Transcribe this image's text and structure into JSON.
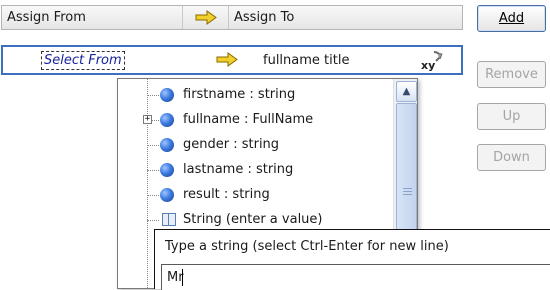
{
  "grid": {
    "headers": {
      "assign_from": "Assign From",
      "assign_to": "Assign To"
    },
    "row": {
      "from": "Select From",
      "to": "fullname title"
    },
    "arrow_icon": "yellow-right-arrow-icon",
    "xy_icon": "xy-function-icon",
    "xy_label": "xy"
  },
  "buttons": [
    {
      "label": "Add",
      "mnemonic_index": 0,
      "enabled": true
    },
    {
      "label": "Remove",
      "mnemonic_index": 0,
      "enabled": false
    },
    {
      "label": "Up",
      "mnemonic_index": 0,
      "enabled": false
    },
    {
      "label": "Down",
      "mnemonic_index": 0,
      "enabled": false
    }
  ],
  "dropdown": {
    "items": [
      {
        "label": "firstname : string",
        "icon": "blue-ball-icon",
        "expandable": false
      },
      {
        "label": "fullname : FullName",
        "icon": "blue-ball-icon",
        "expandable": true
      },
      {
        "label": "gender : string",
        "icon": "blue-ball-icon",
        "expandable": false
      },
      {
        "label": "lastname : string",
        "icon": "blue-ball-icon",
        "expandable": false
      },
      {
        "label": "result : string",
        "icon": "blue-ball-icon",
        "expandable": false
      },
      {
        "label": "String (enter a value)",
        "icon": "string-literal-icon",
        "expandable": false
      }
    ]
  },
  "editor": {
    "hint": "Type a string (select Ctrl-Enter for new line)",
    "value": "Mr"
  },
  "colors": {
    "selection_border": "#3a6fc1",
    "select_from_text": "#17229b",
    "arrow_fill": "#f2cf2a",
    "arrow_stroke": "#8a6b00",
    "ball": "#3d7be0"
  }
}
